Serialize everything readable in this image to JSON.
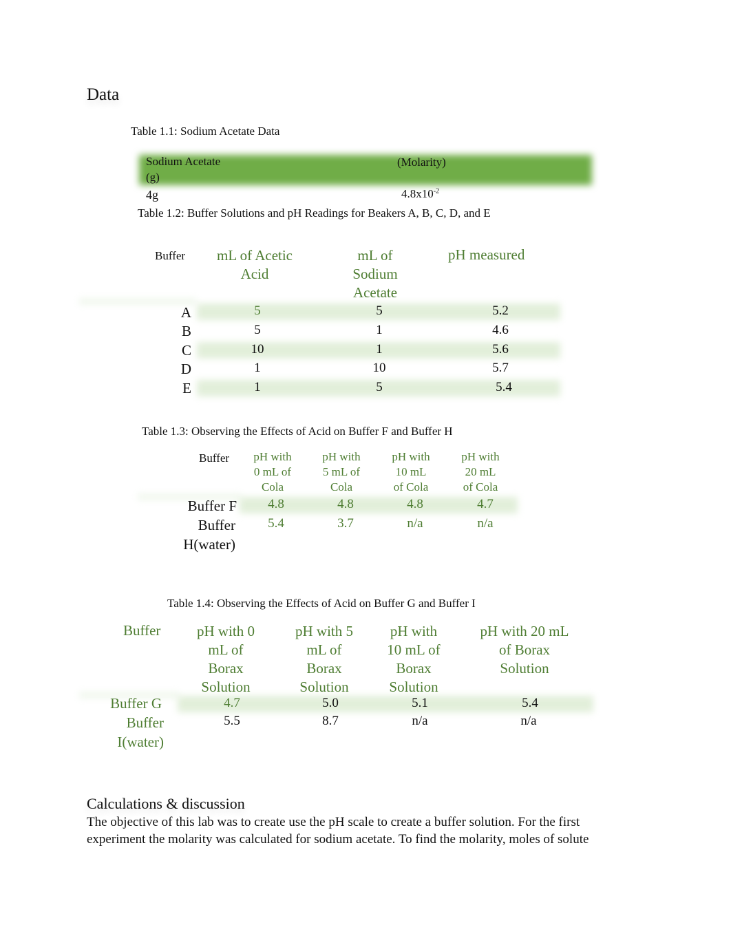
{
  "headings": {
    "data": "Data",
    "calculations": "Calculations & discussion"
  },
  "table1": {
    "caption": "Table 1.1: Sodium Acetate Data",
    "headers": [
      "Sodium Acetate\n(g)",
      "(Molarity)"
    ],
    "row": {
      "grams": "4g",
      "molarity_base": "4.8x10",
      "molarity_exp": "-2"
    },
    "header_color": "#70ad47"
  },
  "table2": {
    "caption": "Table 1.2: Buffer Solutions and pH Readings for Beakers A, B, C, D, and E",
    "headers": [
      "Buffer",
      "mL of Acetic\nAcid",
      "mL of\nSodium\nAcetate",
      "pH measured"
    ],
    "rows": [
      {
        "buffer": "A",
        "acetic": "5",
        "sodium": "5",
        "ph": "5.2"
      },
      {
        "buffer": "B",
        "acetic": "5",
        "sodium": "1",
        "ph": "4.6"
      },
      {
        "buffer": "C",
        "acetic": "10",
        "sodium": "1",
        "ph": "5.6"
      },
      {
        "buffer": "D",
        "acetic": "1",
        "sodium": "10",
        "ph": "5.7"
      },
      {
        "buffer": "E",
        "acetic": "1",
        "sodium": "5",
        "ph": "5.4"
      }
    ],
    "band_color": "#e2efda"
  },
  "table3": {
    "caption": "Table 1.3: Observing the Effects of Acid on Buffer F and Buffer H",
    "headers": [
      "Buffer",
      "pH with\n0 mL of\nCola",
      "pH with\n5 mL of\nCola",
      "pH with\n10 mL\nof Cola",
      "pH with\n20 mL\nof Cola"
    ],
    "rows": [
      {
        "buffer": "Buffer F",
        "values": [
          "4.8",
          "4.8",
          "4.8",
          "4.7"
        ]
      },
      {
        "buffer": "Buffer\nH(water)",
        "values": [
          "5.4",
          "3.7",
          "n/a",
          "n/a"
        ]
      }
    ]
  },
  "table4": {
    "caption": "Table 1.4: Observing the Effects of Acid on Buffer G and Buffer I",
    "headers": [
      "Buffer",
      "pH with 0\nmL of\nBorax\nSolution",
      "pH with 5\nmL of\nBorax\nSolution",
      "pH with\n10 mL of\nBorax\nSolution",
      "pH with 20 mL\nof Borax\nSolution"
    ],
    "rows": [
      {
        "buffer": "Buffer G",
        "values": [
          "4.7",
          "5.0",
          "5.1",
          "5.4"
        ]
      },
      {
        "buffer": "Buffer\nI(water)",
        "values": [
          "5.5",
          "8.7",
          "n/a",
          "n/a"
        ]
      }
    ]
  },
  "discussion": {
    "lines": [
      "The objective of this lab was to create use the pH scale to create a buffer solution. For the first",
      "experiment the molarity was calculated for sodium acetate. To find the molarity, moles of solute"
    ]
  },
  "colors": {
    "accent_green": "#4e7d32",
    "header_green": "#70ad47",
    "band_green": "#e2efda"
  }
}
